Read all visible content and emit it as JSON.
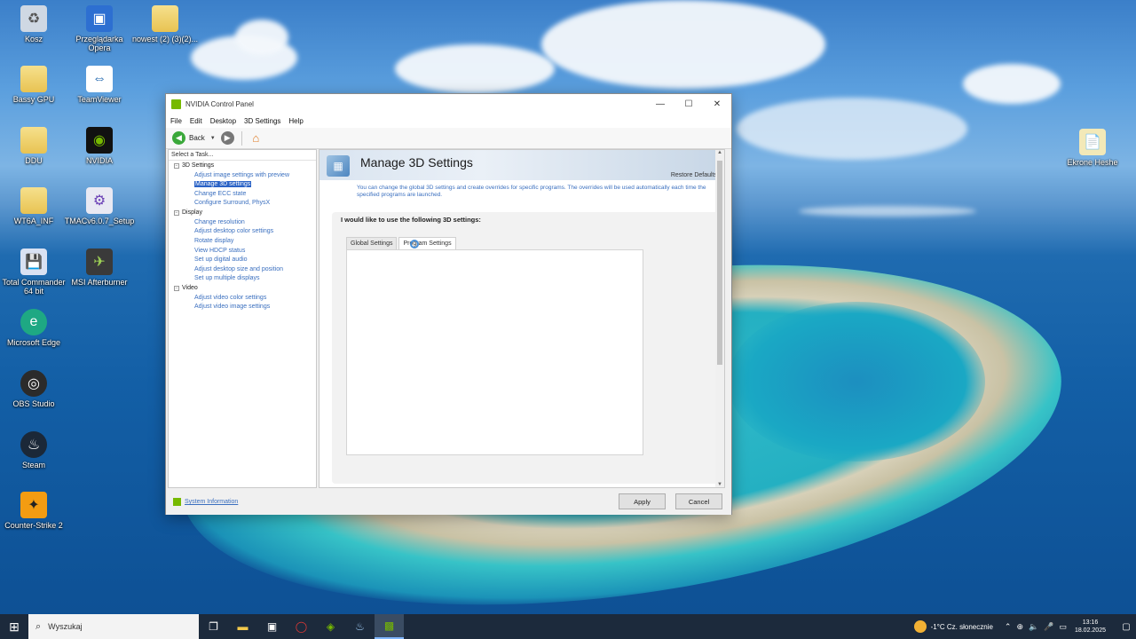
{
  "desktop": {
    "icons": [
      {
        "label": "Kosz",
        "icon": "recycle-bin-icon"
      },
      {
        "label": "Przeglądarka Opera",
        "icon": "shortcut-icon"
      },
      {
        "label": "nowest (2) (3)(2)...",
        "icon": "folder-icon"
      },
      {
        "label": "Bassy GPU",
        "icon": "folder-icon"
      },
      {
        "label": "TeamViewer",
        "icon": "teamviewer-icon"
      },
      {
        "label": "DDU",
        "icon": "folder-icon"
      },
      {
        "label": "NVIDIA",
        "icon": "nvidia-icon"
      },
      {
        "label": "WT6A_INF",
        "icon": "folder-icon"
      },
      {
        "label": "TMACv6.0.7_Setup",
        "icon": "setup-icon"
      },
      {
        "label": "Total Commander 64 bit",
        "icon": "total-commander-icon"
      },
      {
        "label": "MSI Afterburner",
        "icon": "msi-afterburner-icon"
      },
      {
        "label": "Microsoft Edge",
        "icon": "edge-icon"
      },
      {
        "label": "OBS Studio",
        "icon": "obs-icon"
      },
      {
        "label": "Steam",
        "icon": "steam-icon"
      },
      {
        "label": "Counter-Strike 2",
        "icon": "cs2-icon"
      },
      {
        "label": "Ekrone Heshe",
        "icon": "document-icon"
      }
    ]
  },
  "window": {
    "title": "NVIDIA Control Panel",
    "controls": {
      "minimize": "—",
      "maximize": "☐",
      "close": "✕"
    },
    "menu": [
      "File",
      "Edit",
      "Desktop",
      "3D Settings",
      "Help"
    ],
    "toolbar": {
      "back_label": "Back"
    },
    "task_header": "Select a Task...",
    "tree": [
      {
        "category": "3D Settings",
        "items": [
          "Adjust image settings with preview",
          "Manage 3D settings",
          "Change ECC state",
          "Configure Surround, PhysX"
        ]
      },
      {
        "category": "Display",
        "items": [
          "Change resolution",
          "Adjust desktop color settings",
          "Rotate display",
          "View HDCP status",
          "Set up digital audio",
          "Adjust desktop size and position",
          "Set up multiple displays"
        ]
      },
      {
        "category": "Video",
        "items": [
          "Adjust video color settings",
          "Adjust video image settings"
        ]
      }
    ],
    "selected_item": "Manage 3D settings",
    "page": {
      "title": "Manage 3D Settings",
      "restore_defaults": "Restore Defaults",
      "description": "You can change the global 3D settings and create overrides for specific programs. The overrides will be used automatically each time the specified programs are launched.",
      "section_title": "I would like to use the following 3D settings:",
      "tabs": [
        "Global Settings",
        "Program Settings"
      ],
      "active_tab": "Program Settings"
    },
    "footer": {
      "system_info": "System Information",
      "apply": "Apply",
      "cancel": "Cancel"
    }
  },
  "taskbar": {
    "search_placeholder": "Wyszukaj",
    "apps": [
      "task-view-icon",
      "file-explorer-icon",
      "tablet-icon",
      "opera-gx-icon",
      "nvidia-app-icon",
      "steam-icon",
      "nvidia-control-panel-icon"
    ],
    "weather": "-1°C  Cz. słonecznie",
    "time": "13:16",
    "date": "18.02.2025"
  }
}
